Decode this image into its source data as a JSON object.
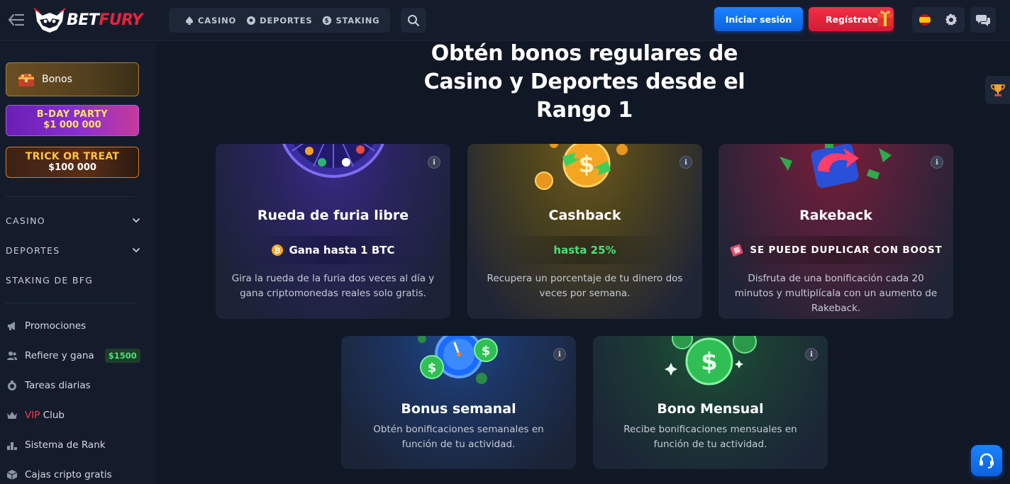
{
  "header": {
    "logo_bet": "BET",
    "logo_fury": "FURY",
    "nav": [
      {
        "label": "CASINO",
        "icon": "spade-icon"
      },
      {
        "label": "DEPORTES",
        "icon": "ball-icon"
      },
      {
        "label": "STAKING",
        "icon": "coin-icon"
      }
    ],
    "login_label": "Iniciar sesión",
    "register_label": "Regístrate",
    "language": "es"
  },
  "sidebar": {
    "bonos_label": "Bonos",
    "bday_line1": "B-DAY PARTY",
    "bday_line2": "$1 000 000",
    "trick_line1": "TRICK OR TREAT",
    "trick_line2": "$100 000",
    "categories": [
      {
        "label": "CASINO"
      },
      {
        "label": "DEPORTES"
      },
      {
        "label": "STAKING DE BFG"
      }
    ],
    "links": [
      {
        "label": "Promociones",
        "icon": "megaphone-icon"
      },
      {
        "label": "Refiere y gana",
        "icon": "users-icon",
        "badge": "$1500"
      },
      {
        "label": "Tareas diarias",
        "icon": "tasks-icon"
      },
      {
        "vip_prefix": "VIP",
        "label": " Club",
        "icon": "crown-icon"
      },
      {
        "label": "Sistema de Rank",
        "icon": "rank-icon"
      },
      {
        "label": "Cajas cripto gratis",
        "icon": "box-icon"
      }
    ]
  },
  "main": {
    "title": "Obtén bonos regulares de Casino y Deportes desde el Rango 1",
    "cards": [
      {
        "title": "Rueda de furia libre",
        "highlight": "Gana hasta 1 BTC",
        "desc": "Gira la rueda de la furia dos veces al día y gana criptomonedas reales solo gratis."
      },
      {
        "title": "Cashback",
        "highlight": "hasta 25%",
        "desc": "Recupera un porcentaje de tu dinero dos veces por semana."
      },
      {
        "title": "Rakeback",
        "highlight": "SE PUEDE DUPLICAR CON BOOST",
        "desc": "Disfruta de una bonificación cada 20 minutos y multiplícala con un aumento de Rakeback."
      },
      {
        "title": "Bonus semanal",
        "desc": "Obtén bonificaciones semanales en función de tu actividad."
      },
      {
        "title": "Bono Mensual",
        "desc": "Recibe bonificaciones mensuales en función de tu actividad."
      }
    ]
  },
  "colors": {
    "accent_blue": "#1b83ff",
    "accent_red": "#e8243c",
    "bg": "#101725",
    "green": "#4be07a"
  }
}
